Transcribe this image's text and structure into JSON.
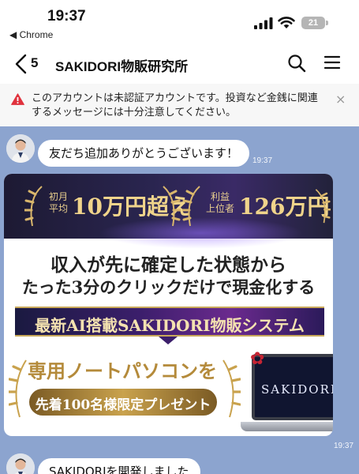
{
  "status_bar": {
    "time": "19:37",
    "back_app": "◀ Chrome",
    "battery": "21"
  },
  "header": {
    "unread_count": "5",
    "title": "SAKIDORI物販研究所",
    "icons": [
      "back-chevron-icon",
      "search-icon",
      "menu-icon"
    ]
  },
  "warning": {
    "text": "このアカウントは未認証アカウントです。投資など金銭に関連するメッセージには十分注意してください。",
    "icon": "warning-icon",
    "close": "×",
    "color": "#e0323d"
  },
  "chat": {
    "background": "#8ca4cf",
    "messages": [
      {
        "text": "友だち追加ありがとうございます！",
        "time": "19:37"
      },
      {
        "type": "image",
        "time": "19:37"
      },
      {
        "text": "SAKIDORIを開発しました"
      }
    ]
  },
  "promo": {
    "award_left_small": "初月\n平均",
    "award_left_big": "10万円超え",
    "award_right_small": "利益\n上位者",
    "award_right_big": "126万円",
    "headline_1": "収入が先に確定した状態から",
    "headline_2": "たった3分のクリックだけで現金化する",
    "banner": "最新AI搭載SAKIDORI物販システム",
    "laptop_text": "専用ノートパソコンを",
    "gift_text": "先着100名様限定プレゼント",
    "laptop_logo": "SAKIDORI"
  }
}
